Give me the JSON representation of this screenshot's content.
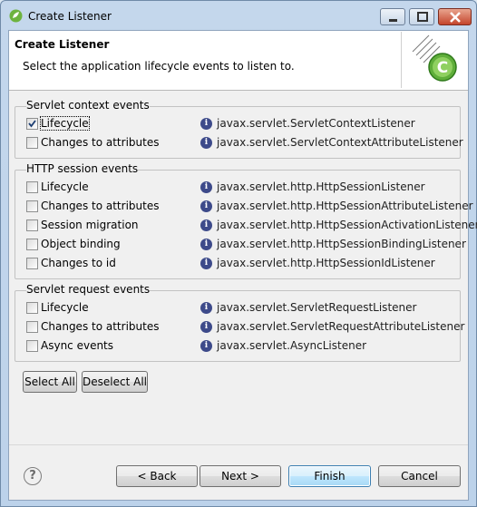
{
  "window": {
    "title": "Create Listener",
    "icon": "spring-leaf-icon",
    "controls": [
      "minimize-icon",
      "maximize-icon",
      "close-icon"
    ]
  },
  "banner": {
    "title": "Create Listener",
    "description": "Select the application lifecycle events to listen to."
  },
  "groups": [
    {
      "title": "Servlet context events",
      "rows": [
        {
          "label": "Lifecycle",
          "checked": true,
          "interface": "javax.servlet.ServletContextListener"
        },
        {
          "label": "Changes to attributes",
          "checked": false,
          "interface": "javax.servlet.ServletContextAttributeListener"
        }
      ]
    },
    {
      "title": "HTTP session events",
      "rows": [
        {
          "label": "Lifecycle",
          "checked": false,
          "interface": "javax.servlet.http.HttpSessionListener"
        },
        {
          "label": "Changes to attributes",
          "checked": false,
          "interface": "javax.servlet.http.HttpSessionAttributeListener"
        },
        {
          "label": "Session migration",
          "checked": false,
          "interface": "javax.servlet.http.HttpSessionActivationListener"
        },
        {
          "label": "Object binding",
          "checked": false,
          "interface": "javax.servlet.http.HttpSessionBindingListener"
        },
        {
          "label": "Changes to id",
          "checked": false,
          "interface": "javax.servlet.http.HttpSessionIdListener"
        }
      ]
    },
    {
      "title": "Servlet request events",
      "rows": [
        {
          "label": "Lifecycle",
          "checked": false,
          "interface": "javax.servlet.ServletRequestListener"
        },
        {
          "label": "Changes to attributes",
          "checked": false,
          "interface": "javax.servlet.ServletRequestAttributeListener"
        },
        {
          "label": "Async events",
          "checked": false,
          "interface": "javax.servlet.AsyncListener"
        }
      ]
    }
  ],
  "selection_buttons": {
    "select_all": "Select All",
    "deselect_all": "Deselect All"
  },
  "footer": {
    "help": "?",
    "back": "< Back",
    "next": "Next >",
    "finish": "Finish",
    "cancel": "Cancel"
  },
  "colors": {
    "title_bar": "#c4d7ec",
    "info_icon": "#3d4a8a",
    "default_button": "#a7d9f5"
  }
}
